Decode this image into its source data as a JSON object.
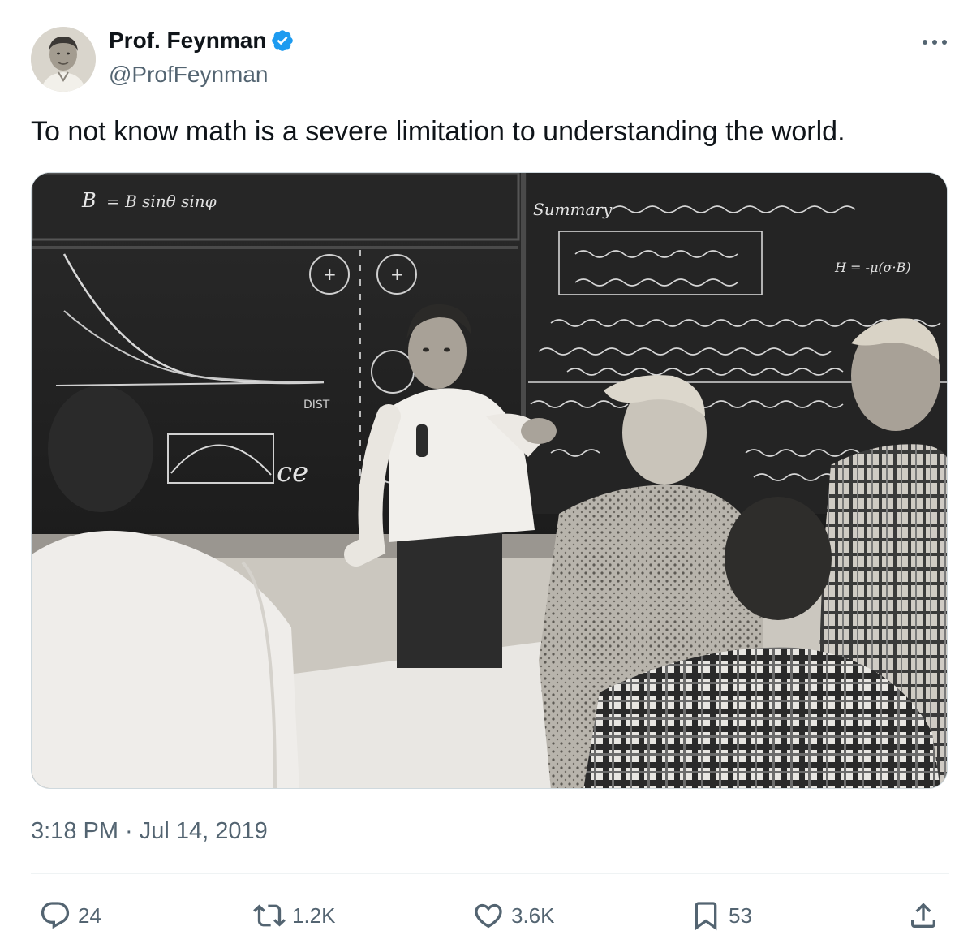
{
  "author": {
    "display_name": "Prof. Feynman",
    "handle": "@ProfFeynman",
    "verified_icon": "verified-badge-icon",
    "avatar_icon": "avatar-portrait"
  },
  "tweet": {
    "text": "To not know math is a severe limitation to understanding the world.",
    "timestamp": "3:18 PM · Jul 14, 2019"
  },
  "media": {
    "icon": "photo-feynman-lecturing-at-blackboard",
    "chalk": {
      "top_left": "B",
      "top_left_formula": "= B sinθ sinφ",
      "dist_label": "DIST",
      "boltzmann": "ce",
      "summary": "Summary",
      "h_formula": "H = -μ(σ·B)"
    }
  },
  "actions": {
    "reply_count": "24",
    "retweet_count": "1.2K",
    "like_count": "3.6K",
    "bookmark_count": "53"
  },
  "colors": {
    "text_primary": "#0f1419",
    "text_secondary": "#536471",
    "verified": "#1d9bf0",
    "divider": "#eff3f4"
  }
}
